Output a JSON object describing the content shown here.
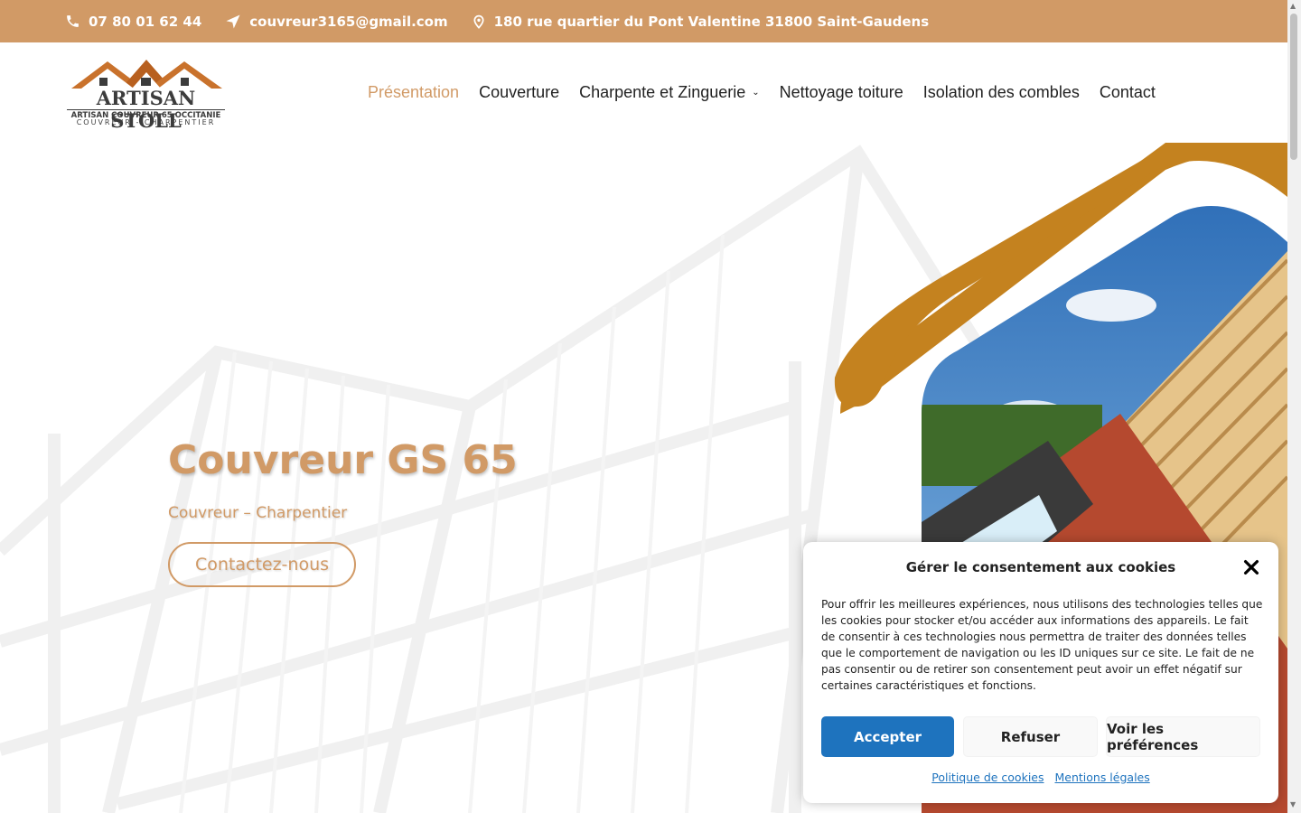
{
  "topbar": {
    "phone": "07 80 01 62 44",
    "email": "couvreur3165@gmail.com",
    "address": "180 rue quartier du Pont Valentine 31800 Saint-Gaudens",
    "bg_color": "#d19a66"
  },
  "logo": {
    "brand": "ARTISAN STOLL",
    "line1": "ARTISAN COUVREUR 65 OCCITANIE",
    "line2": "COUVREUR - CHARPENTIER"
  },
  "nav": {
    "items": [
      {
        "label": "Présentation",
        "active": true
      },
      {
        "label": "Couverture"
      },
      {
        "label": "Charpente et Zinguerie",
        "has_dropdown": true
      },
      {
        "label": "Nettoyage toiture"
      },
      {
        "label": "Isolation des combles"
      },
      {
        "label": "Contact"
      }
    ],
    "active_color": "#d19a66"
  },
  "hero": {
    "title": "Couvreur GS 65",
    "subtitle": "Couvreur – Charpentier",
    "cta": "Contactez-nous",
    "accent_color": "#c4821f"
  },
  "cookie": {
    "title": "Gérer le consentement aux cookies",
    "body": "Pour offrir les meilleures expériences, nous utilisons des technologies telles que les cookies pour stocker et/ou accéder aux informations des appareils. Le fait de consentir à ces technologies nous permettra de traiter des données telles que le comportement de navigation ou les ID uniques sur ce site. Le fait de ne pas consentir ou de retirer son consentement peut avoir un effet négatif sur certaines caractéristiques et fonctions.",
    "accept": "Accepter",
    "refuse": "Refuser",
    "preferences": "Voir les préférences",
    "link_cookies": "Politique de cookies",
    "link_legal": "Mentions légales",
    "accept_color": "#1e73be"
  }
}
